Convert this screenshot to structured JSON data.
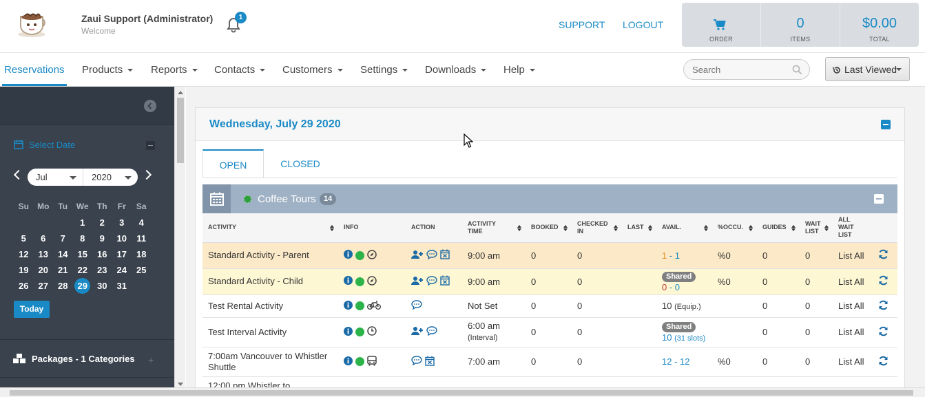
{
  "header": {
    "user_name": "Zaui Support (Administrator)",
    "user_sub": "Welcome",
    "notifications_count": "1",
    "support_link": "SUPPORT",
    "logout_link": "LOGOUT",
    "cart": {
      "order_label": "ORDER",
      "items_value": "0",
      "items_label": "ITEMS",
      "total_value": "$0.00",
      "total_label": "TOTAL"
    }
  },
  "nav": {
    "items": [
      {
        "label": "Reservations"
      },
      {
        "label": "Products"
      },
      {
        "label": "Reports"
      },
      {
        "label": "Contacts"
      },
      {
        "label": "Customers"
      },
      {
        "label": "Settings"
      },
      {
        "label": "Downloads"
      },
      {
        "label": "Help"
      }
    ],
    "search_placeholder": "Search",
    "last_viewed_label": "Last Viewed"
  },
  "sidebar": {
    "select_date_label": "Select Date",
    "month": "Jul",
    "year": "2020",
    "weekdays": [
      "Su",
      "Mo",
      "Tu",
      "We",
      "Th",
      "Fr",
      "Sa"
    ],
    "weeks": [
      [
        "",
        "",
        "",
        "1",
        "2",
        "3",
        "4"
      ],
      [
        "5",
        "6",
        "7",
        "8",
        "9",
        "10",
        "11"
      ],
      [
        "12",
        "13",
        "14",
        "15",
        "16",
        "17",
        "18"
      ],
      [
        "19",
        "20",
        "21",
        "22",
        "23",
        "24",
        "25"
      ],
      [
        "26",
        "27",
        "28",
        "29",
        "30",
        "31",
        ""
      ]
    ],
    "selected_day": "29",
    "today_label": "Today",
    "packages_label": "Packages - 1 Categories"
  },
  "main": {
    "date_title": "Wednesday, July 29 2020",
    "tabs": [
      {
        "label": "OPEN"
      },
      {
        "label": "CLOSED"
      }
    ],
    "category": {
      "name": "Coffee Tours",
      "count": "14"
    },
    "columns": {
      "activity": "ACTIVITY",
      "info": "INFO",
      "action": "ACTION",
      "activity_time_1": "ACTIVITY",
      "activity_time_2": "TIME",
      "booked": "BOOKED",
      "checked_in_1": "CHECKED",
      "checked_in_2": "IN",
      "last": "LAST",
      "avail": "AVAIL.",
      "occu": "%OCCU.",
      "guides": "GUIDES",
      "wait_list_1": "WAIT",
      "wait_list_2": "LIST",
      "all_wait_list_1": "ALL",
      "all_wait_list_2": "WAIT",
      "all_wait_list_3": "LIST"
    },
    "rows": [
      {
        "name": "Standard Activity - Parent",
        "time": "9:00 am",
        "time_sub": "",
        "booked": "0",
        "checked_in": "0",
        "avail_badge": "",
        "avail_a": "1",
        "avail_sep": " - ",
        "avail_b": "1",
        "avail_sub": "",
        "occu": "%0",
        "guides": "0",
        "wait": "0",
        "list_all": "List All"
      },
      {
        "name": "Standard Activity - Child",
        "time": "9:00 am",
        "time_sub": "",
        "booked": "0",
        "checked_in": "0",
        "avail_badge": "Shared",
        "avail_a": "0",
        "avail_sep": " - ",
        "avail_b": "0",
        "avail_sub": "",
        "occu": "%0",
        "guides": "0",
        "wait": "0",
        "list_all": "List All"
      },
      {
        "name": "Test Rental Activity",
        "time": "Not Set",
        "time_sub": "",
        "booked": "0",
        "checked_in": "0",
        "avail_badge": "",
        "avail_a": "10",
        "avail_sep": "",
        "avail_b": "",
        "avail_sub": "(Equip.)",
        "occu": "",
        "guides": "0",
        "wait": "0",
        "list_all": "List All"
      },
      {
        "name": "Test Interval Activity",
        "time": "6:00 am",
        "time_sub": "(Interval)",
        "booked": "0",
        "checked_in": "0",
        "avail_badge": "Shared",
        "avail_a": "10",
        "avail_sep": "",
        "avail_b": "",
        "avail_sub": "(31 slots)",
        "occu": "",
        "guides": "0",
        "wait": "0",
        "list_all": "List All"
      },
      {
        "name": "7:00am Vancouver to Whistler Shuttle",
        "time": "7:00 am",
        "time_sub": "",
        "booked": "0",
        "checked_in": "0",
        "avail_badge": "",
        "avail_a": "12",
        "avail_sep": " - ",
        "avail_b": "12",
        "avail_sub": "",
        "occu": "%0",
        "guides": "0",
        "wait": "0",
        "list_all": "List All"
      },
      {
        "name": "12:00 pm Whistler to",
        "time": "",
        "time_sub": "",
        "booked": "",
        "checked_in": "",
        "avail_badge": "",
        "avail_a": "",
        "avail_sep": "",
        "avail_b": "",
        "avail_sub": "",
        "occu": "",
        "guides": "",
        "wait": "",
        "list_all": ""
      }
    ]
  },
  "colors": {
    "accent": "#1a8ac6",
    "sidebar": "#39424d",
    "category_bar": "#9fb1c4",
    "row_orange": "#fbe9c7",
    "row_yellow": "#fdf7d4",
    "status_green": "#2cb34a"
  }
}
